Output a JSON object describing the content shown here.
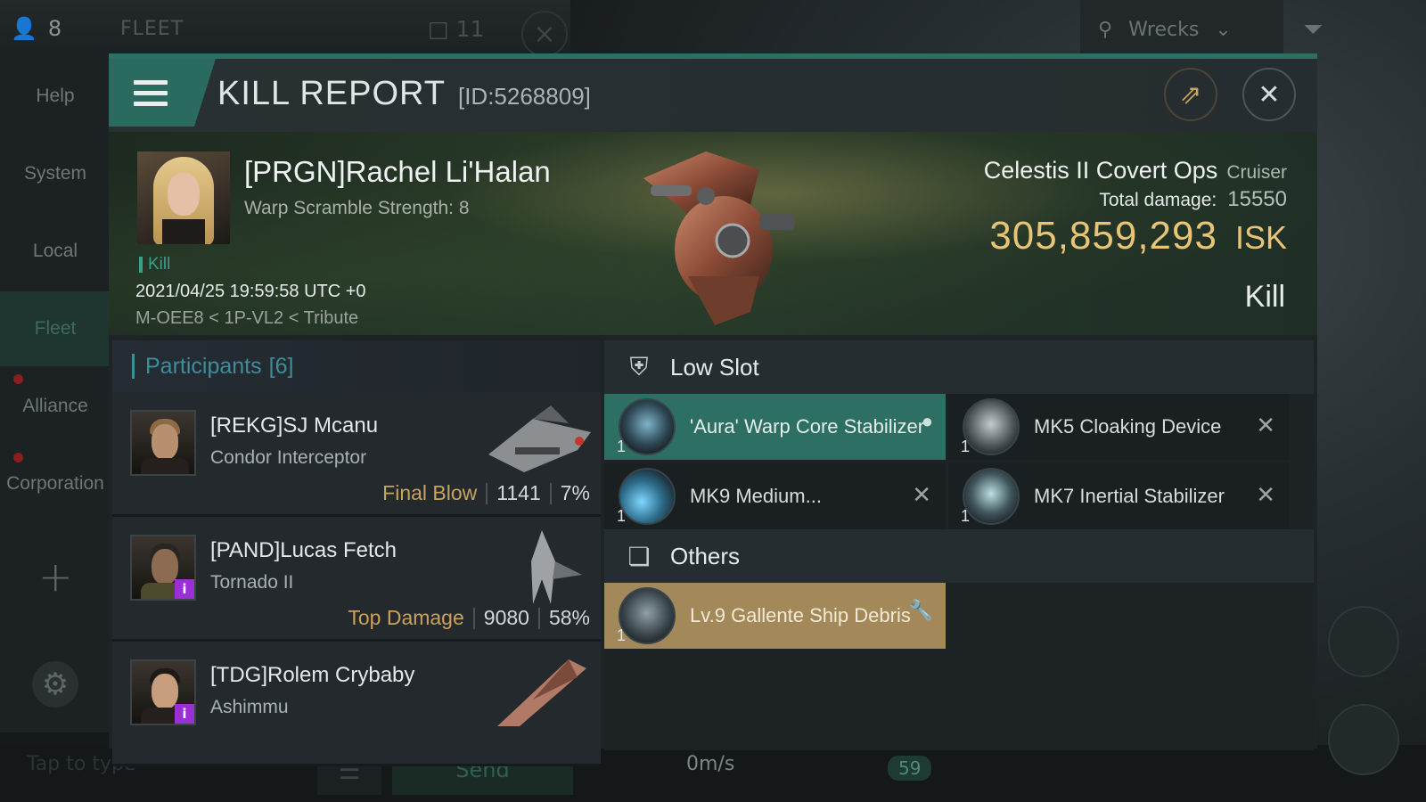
{
  "hud": {
    "fleet_count": "8",
    "fleet_label": "FLEET",
    "fleet_members": "11",
    "filter_label": "Wrecks",
    "sidebar": [
      {
        "label": "Help"
      },
      {
        "label": "System"
      },
      {
        "label": "Local"
      },
      {
        "label": "Fleet"
      },
      {
        "label": "Alliance"
      },
      {
        "label": "Corporation"
      }
    ],
    "chat_placeholder": "Tap to type",
    "send_label": "Send",
    "speed": "0m/s",
    "hud_counter": "59"
  },
  "report": {
    "title": "KILL REPORT",
    "id": "[ID:5268809]",
    "victim": {
      "name": "[PRGN]Rachel Li'Halan",
      "warp_scramble": "Warp Scramble Strength: 8",
      "tag": "Kill",
      "datetime": "2021/04/25 19:59:58 UTC +0",
      "location": "M-OEE8 < 1P-VL2 < Tribute"
    },
    "ship": {
      "name": "Celestis II Covert Ops",
      "class": "Cruiser",
      "total_damage_label": "Total damage:",
      "total_damage": "15550",
      "value": "305,859,293",
      "currency": "ISK",
      "result": "Kill"
    },
    "participants_label": "Participants",
    "participants_count": "[6]",
    "participants": [
      {
        "name": "[REKG]SJ Mcanu",
        "ship": "Condor Interceptor",
        "tag": "Final Blow",
        "damage": "1141",
        "percent": "7%"
      },
      {
        "name": "[PAND]Lucas Fetch",
        "ship": "Tornado II",
        "tag": "Top Damage",
        "damage": "9080",
        "percent": "58%"
      },
      {
        "name": "[TDG]Rolem Crybaby",
        "ship": "Ashimmu"
      }
    ],
    "low_slot_label": "Low Slot",
    "low_slot": [
      {
        "name": "'Aura' Warp Core Stabilizer",
        "qty": "1"
      },
      {
        "name": "MK5 Cloaking Device",
        "qty": "1"
      },
      {
        "name": "MK9 Medium...",
        "qty": "1"
      },
      {
        "name": "MK7 Inertial Stabilizer",
        "qty": "1"
      }
    ],
    "others_label": "Others",
    "others": [
      {
        "name": "Lv.9 Gallente Ship Debris",
        "qty": "1"
      }
    ]
  },
  "colors": {
    "accent": "#2b6a5e",
    "isk_gold": "#e7c476",
    "dropped_green": "#2d6f62",
    "loot_gold": "#a3895a"
  }
}
